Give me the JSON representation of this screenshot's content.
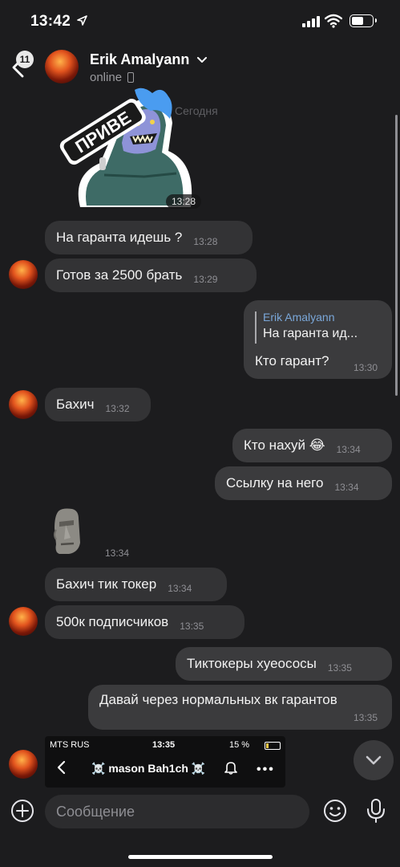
{
  "status_bar": {
    "time": "13:42"
  },
  "header": {
    "back_badge": "11",
    "name": "Erik Amalyann",
    "status": "online"
  },
  "day_label": "Сегодня",
  "sticker": {
    "text": "ПРИВЕ",
    "time": "13:28"
  },
  "messages": [
    {
      "id": "m1",
      "dir": "in",
      "text": "На гаранта идешь ?",
      "time": "13:28"
    },
    {
      "id": "m2",
      "dir": "in",
      "text": "Готов за 2500 брать",
      "time": "13:29"
    },
    {
      "id": "m3",
      "dir": "out",
      "reply_to_name": "Erik Amalyann",
      "reply_to_text": "На гаранта ид...",
      "text": "Кто гарант?",
      "time": "13:30"
    },
    {
      "id": "m4",
      "dir": "in",
      "text": "Бахич",
      "time": "13:32"
    },
    {
      "id": "m5",
      "dir": "out",
      "text": "Кто нахуй 😂",
      "time": "13:34"
    },
    {
      "id": "m6",
      "dir": "out",
      "text": "Ссылку на него",
      "time": "13:34"
    },
    {
      "id": "m7",
      "dir": "in",
      "sticker": "moai",
      "time": "13:34"
    },
    {
      "id": "m8",
      "dir": "in",
      "text": "Бахич тик токер",
      "time": "13:34"
    },
    {
      "id": "m9",
      "dir": "in",
      "text": "500к подписчиков",
      "time": "13:35"
    },
    {
      "id": "m10",
      "dir": "out",
      "text": "Тиктокеры хуеососы",
      "time": "13:35"
    },
    {
      "id": "m11",
      "dir": "out",
      "text": "Давай через нормальных вк гарантов",
      "time": "13:35"
    }
  ],
  "embedded_screenshot": {
    "carrier": "MTS RUS",
    "time": "13:35",
    "battery": "15 %",
    "title": "☠️ mason Bah1ch ☠️"
  },
  "composer": {
    "placeholder": "Сообщение"
  },
  "colors": {
    "background": "#1c1c1e",
    "incoming_bubble": "#333335",
    "outgoing_bubble": "#3b3b3d",
    "reply_name": "#7aa7d9"
  }
}
